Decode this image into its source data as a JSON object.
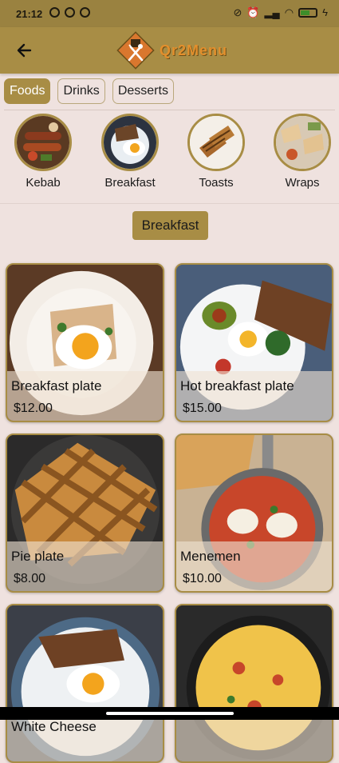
{
  "status_bar": {
    "time": "21:12",
    "left_icons": [
      "notification-icon",
      "notification-icon",
      "notification-icon"
    ],
    "right_icons": [
      "dnd-icon",
      "alarm-icon",
      "signal-icon",
      "wifi-icon",
      "battery-icon",
      "charging-icon"
    ]
  },
  "app_bar": {
    "back_icon": "back-arrow-icon",
    "brand": "Qr2Menu"
  },
  "tabs": [
    {
      "label": "Foods",
      "active": true
    },
    {
      "label": "Drinks",
      "active": false
    },
    {
      "label": "Desserts",
      "active": false
    }
  ],
  "categories": [
    {
      "label": "Kebab"
    },
    {
      "label": "Breakfast"
    },
    {
      "label": "Toasts"
    },
    {
      "label": "Wraps"
    }
  ],
  "section_title": "Breakfast",
  "products": [
    {
      "name": "Breakfast plate",
      "price": "$12.00"
    },
    {
      "name": "Hot breakfast plate",
      "price": "$15.00"
    },
    {
      "name": "Pie plate",
      "price": "$8.00"
    },
    {
      "name": "Menemen",
      "price": "$10.00"
    },
    {
      "name": "White Cheese",
      "price": ""
    },
    {
      "name": "",
      "price": ""
    }
  ],
  "colors": {
    "accent": "#a88d45",
    "status_bar": "#9a8240",
    "background": "#efe2df",
    "brand_text": "#e38f2c"
  }
}
